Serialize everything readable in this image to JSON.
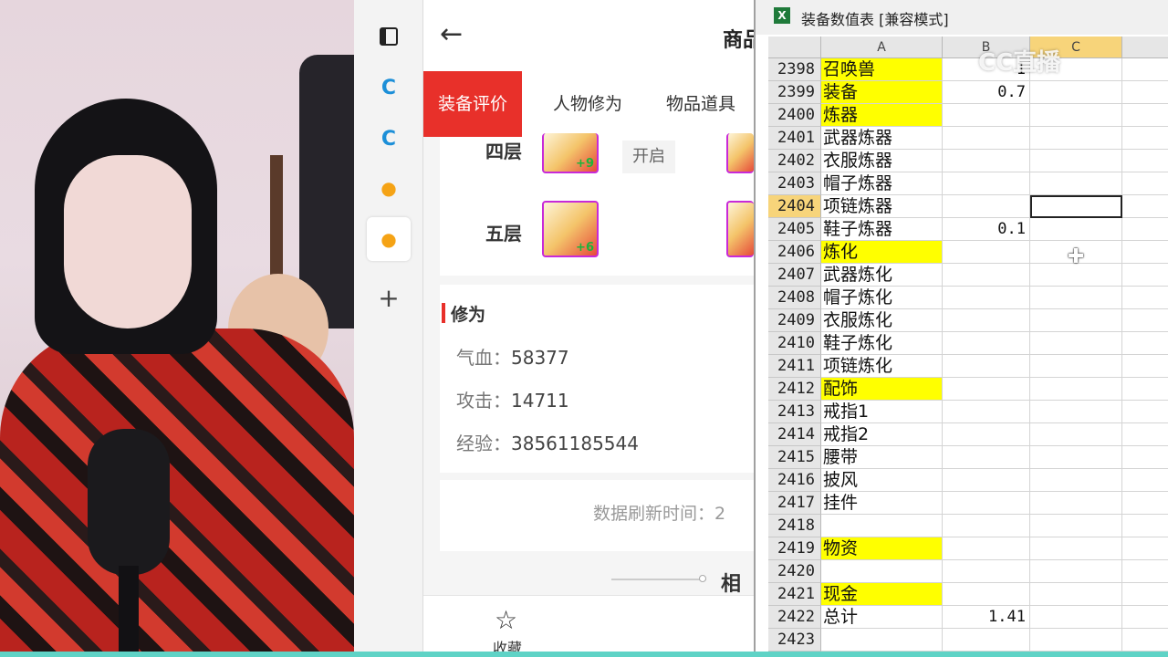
{
  "tab_sidebar": {
    "add_label": "+"
  },
  "app": {
    "title": "商品",
    "tabs": [
      "装备评价",
      "人物修为",
      "物品道具"
    ],
    "floors": [
      {
        "label": "四层",
        "plus": "+9",
        "status": "开启"
      },
      {
        "label": "五层",
        "plus": "+6"
      }
    ],
    "cultivation": {
      "title": "修为",
      "stats": [
        {
          "key": "气血：",
          "value": "58377"
        },
        {
          "key": "攻击：",
          "value": "14711"
        },
        {
          "key": "经验：",
          "value": "38561185544"
        }
      ]
    },
    "refresh_text": "数据刷新时间：2",
    "related_label": "相似",
    "favorite_label": "收藏"
  },
  "excel": {
    "title": "装备数值表  [兼容模式]",
    "columns": [
      "A",
      "B",
      "C"
    ],
    "selected_cell": "C2404",
    "rows": [
      {
        "n": "2398",
        "a": "召唤兽",
        "b": "1",
        "hl": true
      },
      {
        "n": "2399",
        "a": "装备",
        "b": "0.7",
        "hl": true
      },
      {
        "n": "2400",
        "a": "炼器",
        "b": "",
        "hl": true
      },
      {
        "n": "2401",
        "a": "武器炼器",
        "b": ""
      },
      {
        "n": "2402",
        "a": "衣服炼器",
        "b": ""
      },
      {
        "n": "2403",
        "a": "帽子炼器",
        "b": ""
      },
      {
        "n": "2404",
        "a": "项链炼器",
        "b": "",
        "sel": true
      },
      {
        "n": "2405",
        "a": "鞋子炼器",
        "b": "0.1"
      },
      {
        "n": "2406",
        "a": "炼化",
        "b": "",
        "hl": true
      },
      {
        "n": "2407",
        "a": "武器炼化",
        "b": ""
      },
      {
        "n": "2408",
        "a": "帽子炼化",
        "b": ""
      },
      {
        "n": "2409",
        "a": "衣服炼化",
        "b": ""
      },
      {
        "n": "2410",
        "a": "鞋子炼化",
        "b": ""
      },
      {
        "n": "2411",
        "a": "项链炼化",
        "b": ""
      },
      {
        "n": "2412",
        "a": "配饰",
        "b": "",
        "hl": true
      },
      {
        "n": "2413",
        "a": "戒指1",
        "b": ""
      },
      {
        "n": "2414",
        "a": "戒指2",
        "b": ""
      },
      {
        "n": "2415",
        "a": "腰带",
        "b": ""
      },
      {
        "n": "2416",
        "a": "披风",
        "b": ""
      },
      {
        "n": "2417",
        "a": "挂件",
        "b": ""
      },
      {
        "n": "2418",
        "a": "",
        "b": ""
      },
      {
        "n": "2419",
        "a": "物资",
        "b": "",
        "hl": true
      },
      {
        "n": "2420",
        "a": "",
        "b": ""
      },
      {
        "n": "2421",
        "a": "现金",
        "b": "",
        "hl": true
      },
      {
        "n": "2422",
        "a": "总计",
        "b": "1.41"
      },
      {
        "n": "2423",
        "a": "",
        "b": ""
      }
    ]
  },
  "watermark": "CC直播"
}
